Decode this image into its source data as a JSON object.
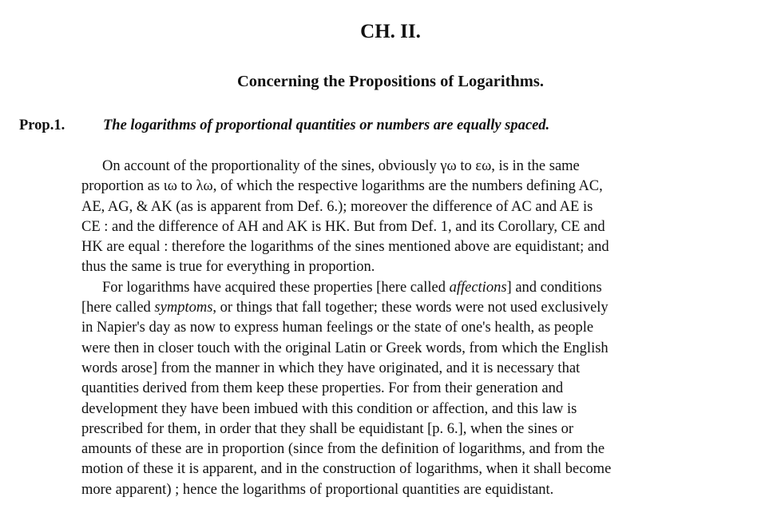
{
  "chapter": "CH. II.",
  "subtitle": "Concerning the Propositions of Logarithms.",
  "proposition": {
    "label": "Prop.1.",
    "statement": "The logarithms of proportional quantities or numbers are equally spaced."
  },
  "paragraph1": [
    "On account of the proportionality of the sines, obviously γω to εω, is in the same",
    "proportion as ιω to λω, of which the respective logarithms are the numbers defining AC,",
    "AE, AG, & AK (as is apparent from Def. 6.); moreover the difference of AC and AE is",
    "CE : and the difference of AH and AK is HK. But from Def. 1, and its Corollary, CE and",
    "HK are equal : therefore the logarithms of the sines mentioned above are equidistant; and",
    "thus the same is true for everything in proportion."
  ],
  "paragraph2": {
    "l1_a": "For logarithms have acquired these properties [here called ",
    "l1_em": "affections",
    "l1_b": "] and conditions",
    "l2_a": "[here called ",
    "l2_em": "symptoms",
    "l2_b": ", or things that fall together; these words were not used exclusively",
    "rest": [
      "in Napier's day as now to express human feelings or the state of one's health, as people",
      "were then in closer touch with the original Latin or Greek words, from which the English",
      "words arose] from the manner in which they have originated, and it is necessary that",
      "quantities derived from them keep these properties.  For from their generation and",
      "development they have been imbued with this condition or affection, and this law is",
      "prescribed for them, in order that they shall be equidistant [p. 6.], when the sines or",
      "amounts of these are in proportion  (since from the definition of logarithms, and from the",
      "motion of these it is apparent, and in the construction of logarithms, when it shall become",
      "more apparent) ; hence the logarithms of proportional quantities are equidistant."
    ]
  }
}
